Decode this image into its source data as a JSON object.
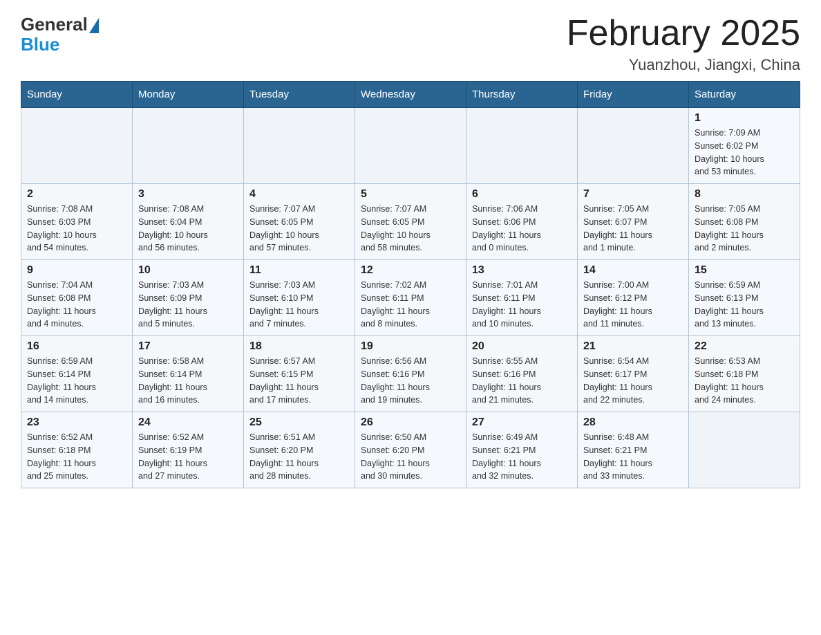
{
  "header": {
    "logo_general": "General",
    "logo_blue": "Blue",
    "month_title": "February 2025",
    "location": "Yuanzhou, Jiangxi, China"
  },
  "weekdays": [
    "Sunday",
    "Monday",
    "Tuesday",
    "Wednesday",
    "Thursday",
    "Friday",
    "Saturday"
  ],
  "weeks": [
    {
      "days": [
        {
          "num": "",
          "info": ""
        },
        {
          "num": "",
          "info": ""
        },
        {
          "num": "",
          "info": ""
        },
        {
          "num": "",
          "info": ""
        },
        {
          "num": "",
          "info": ""
        },
        {
          "num": "",
          "info": ""
        },
        {
          "num": "1",
          "info": "Sunrise: 7:09 AM\nSunset: 6:02 PM\nDaylight: 10 hours\nand 53 minutes."
        }
      ]
    },
    {
      "days": [
        {
          "num": "2",
          "info": "Sunrise: 7:08 AM\nSunset: 6:03 PM\nDaylight: 10 hours\nand 54 minutes."
        },
        {
          "num": "3",
          "info": "Sunrise: 7:08 AM\nSunset: 6:04 PM\nDaylight: 10 hours\nand 56 minutes."
        },
        {
          "num": "4",
          "info": "Sunrise: 7:07 AM\nSunset: 6:05 PM\nDaylight: 10 hours\nand 57 minutes."
        },
        {
          "num": "5",
          "info": "Sunrise: 7:07 AM\nSunset: 6:05 PM\nDaylight: 10 hours\nand 58 minutes."
        },
        {
          "num": "6",
          "info": "Sunrise: 7:06 AM\nSunset: 6:06 PM\nDaylight: 11 hours\nand 0 minutes."
        },
        {
          "num": "7",
          "info": "Sunrise: 7:05 AM\nSunset: 6:07 PM\nDaylight: 11 hours\nand 1 minute."
        },
        {
          "num": "8",
          "info": "Sunrise: 7:05 AM\nSunset: 6:08 PM\nDaylight: 11 hours\nand 2 minutes."
        }
      ]
    },
    {
      "days": [
        {
          "num": "9",
          "info": "Sunrise: 7:04 AM\nSunset: 6:08 PM\nDaylight: 11 hours\nand 4 minutes."
        },
        {
          "num": "10",
          "info": "Sunrise: 7:03 AM\nSunset: 6:09 PM\nDaylight: 11 hours\nand 5 minutes."
        },
        {
          "num": "11",
          "info": "Sunrise: 7:03 AM\nSunset: 6:10 PM\nDaylight: 11 hours\nand 7 minutes."
        },
        {
          "num": "12",
          "info": "Sunrise: 7:02 AM\nSunset: 6:11 PM\nDaylight: 11 hours\nand 8 minutes."
        },
        {
          "num": "13",
          "info": "Sunrise: 7:01 AM\nSunset: 6:11 PM\nDaylight: 11 hours\nand 10 minutes."
        },
        {
          "num": "14",
          "info": "Sunrise: 7:00 AM\nSunset: 6:12 PM\nDaylight: 11 hours\nand 11 minutes."
        },
        {
          "num": "15",
          "info": "Sunrise: 6:59 AM\nSunset: 6:13 PM\nDaylight: 11 hours\nand 13 minutes."
        }
      ]
    },
    {
      "days": [
        {
          "num": "16",
          "info": "Sunrise: 6:59 AM\nSunset: 6:14 PM\nDaylight: 11 hours\nand 14 minutes."
        },
        {
          "num": "17",
          "info": "Sunrise: 6:58 AM\nSunset: 6:14 PM\nDaylight: 11 hours\nand 16 minutes."
        },
        {
          "num": "18",
          "info": "Sunrise: 6:57 AM\nSunset: 6:15 PM\nDaylight: 11 hours\nand 17 minutes."
        },
        {
          "num": "19",
          "info": "Sunrise: 6:56 AM\nSunset: 6:16 PM\nDaylight: 11 hours\nand 19 minutes."
        },
        {
          "num": "20",
          "info": "Sunrise: 6:55 AM\nSunset: 6:16 PM\nDaylight: 11 hours\nand 21 minutes."
        },
        {
          "num": "21",
          "info": "Sunrise: 6:54 AM\nSunset: 6:17 PM\nDaylight: 11 hours\nand 22 minutes."
        },
        {
          "num": "22",
          "info": "Sunrise: 6:53 AM\nSunset: 6:18 PM\nDaylight: 11 hours\nand 24 minutes."
        }
      ]
    },
    {
      "days": [
        {
          "num": "23",
          "info": "Sunrise: 6:52 AM\nSunset: 6:18 PM\nDaylight: 11 hours\nand 25 minutes."
        },
        {
          "num": "24",
          "info": "Sunrise: 6:52 AM\nSunset: 6:19 PM\nDaylight: 11 hours\nand 27 minutes."
        },
        {
          "num": "25",
          "info": "Sunrise: 6:51 AM\nSunset: 6:20 PM\nDaylight: 11 hours\nand 28 minutes."
        },
        {
          "num": "26",
          "info": "Sunrise: 6:50 AM\nSunset: 6:20 PM\nDaylight: 11 hours\nand 30 minutes."
        },
        {
          "num": "27",
          "info": "Sunrise: 6:49 AM\nSunset: 6:21 PM\nDaylight: 11 hours\nand 32 minutes."
        },
        {
          "num": "28",
          "info": "Sunrise: 6:48 AM\nSunset: 6:21 PM\nDaylight: 11 hours\nand 33 minutes."
        },
        {
          "num": "",
          "info": ""
        }
      ]
    }
  ]
}
